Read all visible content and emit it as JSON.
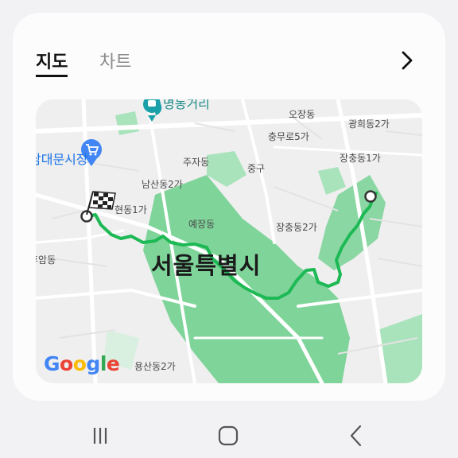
{
  "tabs": {
    "active": "지도",
    "inactive": "차트"
  },
  "icons": {
    "chevron": "chevron-right-icon",
    "subway": "subway-icon",
    "shopping": "shopping-cart-icon"
  },
  "map": {
    "labels": {
      "station": "명동거리",
      "market": "남대문시장",
      "ojang": "오장동",
      "gwanghui": "광희동2가",
      "chungmuro": "충무로5가",
      "jangchung1": "장충동1가",
      "juja": "주자동",
      "jung": "중구",
      "namsan2": "남산동2가",
      "hoehyeon": "회현동1가",
      "yejang": "예장동",
      "jangchung2": "장충동2가",
      "huam": "후암동",
      "yongsan2": "용산동2가",
      "city": "서울특별시"
    },
    "attribution": {
      "G": "G",
      "o1": "o",
      "o2": "o",
      "g": "g",
      "l": "l",
      "e": "e"
    }
  },
  "colors": {
    "route": "#1db954",
    "park": "#7fd49a",
    "parkLight": "#a9e3bb"
  },
  "navbar": {
    "recent": "recent-apps-icon",
    "home": "home-icon",
    "back": "back-icon"
  }
}
